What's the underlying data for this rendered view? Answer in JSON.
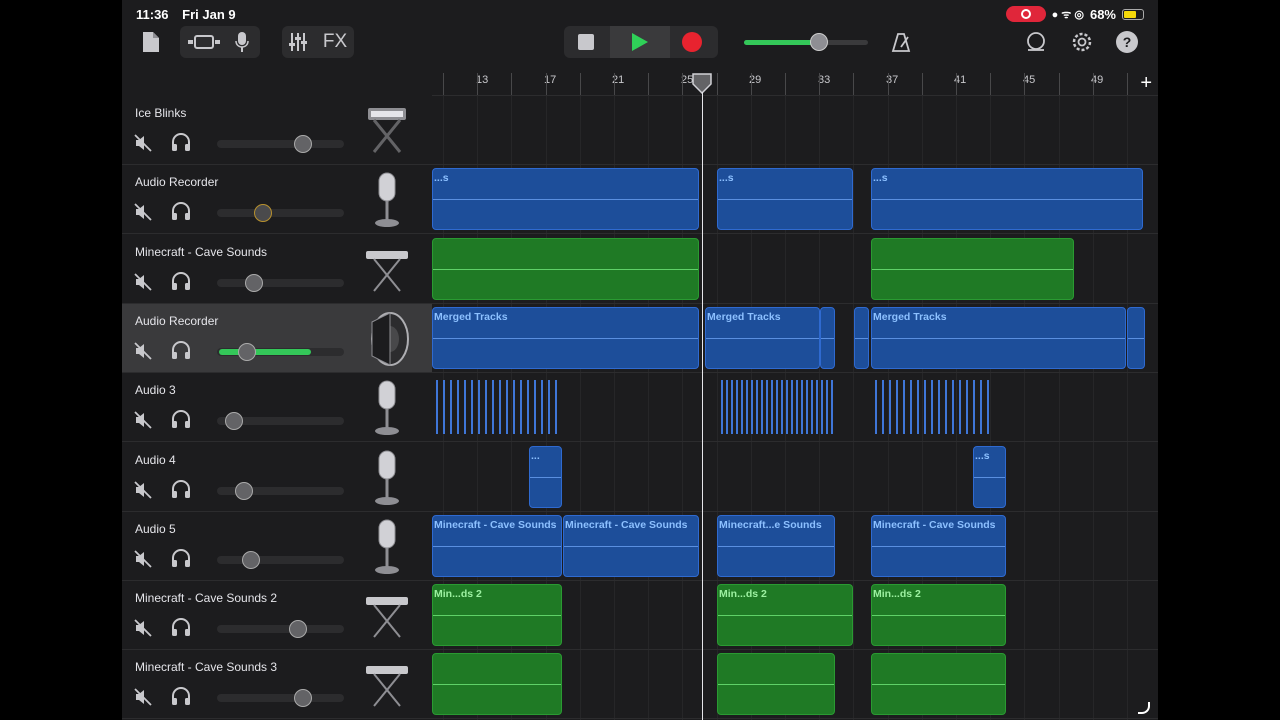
{
  "status": {
    "time": "11:36",
    "date": "Fri Jan 9",
    "battery": "68%"
  },
  "toolbar": {
    "fx_label": "FX",
    "icons": [
      "document-icon",
      "track-view-icon",
      "microphone-icon",
      "mixer-icon",
      "fx-button",
      "stop-icon",
      "play-icon",
      "record-icon",
      "metronome-icon",
      "loop-icon",
      "settings-icon",
      "help-icon"
    ],
    "master_volume": 0.6
  },
  "ruler": {
    "ticks": [
      "13",
      "17",
      "21",
      "25",
      "29",
      "33",
      "37",
      "41",
      "45",
      "49"
    ]
  },
  "tracks": [
    {
      "name": "Ice Blinks",
      "icon": "keyboard-icon",
      "volume": 0.68
    },
    {
      "name": "Audio Recorder",
      "icon": "microphone-icon",
      "volume": 0.36
    },
    {
      "name": "Minecraft - Cave Sounds",
      "icon": "keyboard-stand-icon",
      "volume": 0.29
    },
    {
      "name": "Audio Recorder",
      "icon": "speaker-icon",
      "volume": 0.24,
      "selected": true,
      "level": 0.75
    },
    {
      "name": "Audio 3",
      "icon": "microphone-icon",
      "volume": 0.13
    },
    {
      "name": "Audio 4",
      "icon": "microphone-icon",
      "volume": 0.21
    },
    {
      "name": "Audio 5",
      "icon": "microphone-icon",
      "volume": 0.27
    },
    {
      "name": "Minecraft - Cave Sounds 2",
      "icon": "keyboard-stand-icon",
      "volume": 0.64
    },
    {
      "name": "Minecraft - Cave Sounds 3",
      "icon": "keyboard-stand-icon",
      "volume": 0.68
    }
  ],
  "regions": {
    "audio_recorder_1": [
      "...s",
      "...s",
      "...s"
    ],
    "merged": [
      "Merged Tracks",
      "Merged Tracks",
      "Merged Tracks"
    ],
    "audio4": [
      "...",
      "...s"
    ],
    "audio5": [
      "Minecraft - Cave Sounds",
      "Minecraft - Cave Sounds",
      "Minecraft...e Sounds",
      "Minecraft - Cave Sounds"
    ],
    "cave2": [
      "Min...ds 2",
      "Min...ds 2",
      "Min...ds 2"
    ]
  },
  "colors": {
    "accent_green": "#34c759",
    "record_red": "#e8232f",
    "audio_blue": "#1d4e9a",
    "midi_green": "#1f7a25"
  }
}
